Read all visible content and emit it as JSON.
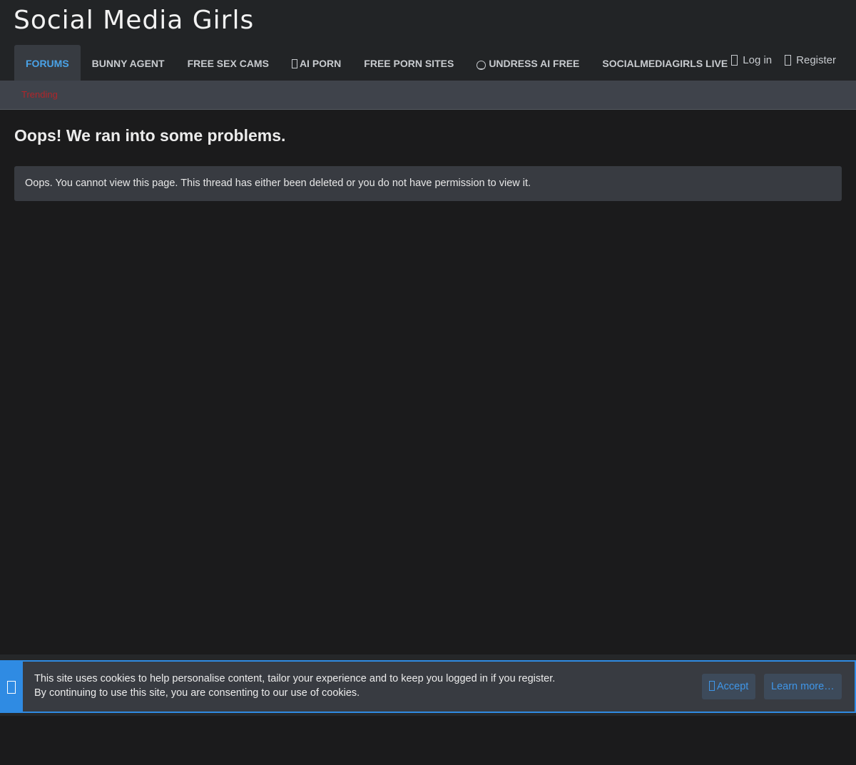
{
  "site": {
    "title": "Social Media Girls"
  },
  "nav": {
    "tabs": [
      {
        "label": "FORUMS"
      },
      {
        "label": "BUNNY AGENT"
      },
      {
        "label": "FREE SEX CAMS"
      },
      {
        "label": "AI PORN"
      },
      {
        "label": "FREE PORN SITES"
      },
      {
        "label": "UNDRESS AI FREE"
      },
      {
        "label": "SOCIALMEDIAGIRLS LIVE"
      }
    ],
    "login": "Log in",
    "register": "Register"
  },
  "subnav": {
    "trending": "Trending"
  },
  "main": {
    "title": "Oops! We ran into some problems.",
    "message": "Oops. You cannot view this page. This thread has either been deleted or you do not have permission to view it."
  },
  "cookie": {
    "line1": "This site uses cookies to help personalise content, tailor your experience and to keep you logged in if you register.",
    "line2": "By continuing to use this site, you are consenting to our use of cookies.",
    "accept": "Accept",
    "learn_more": "Learn more…"
  },
  "colors": {
    "accent": "#2f8be3",
    "active_tab_text": "#4aa3e8",
    "trending": "#b1252a"
  },
  "icons": [
    "nav-link-icon",
    "smile-icon",
    "login-icon",
    "register-icon",
    "cookie-icon",
    "accept-check-icon"
  ]
}
